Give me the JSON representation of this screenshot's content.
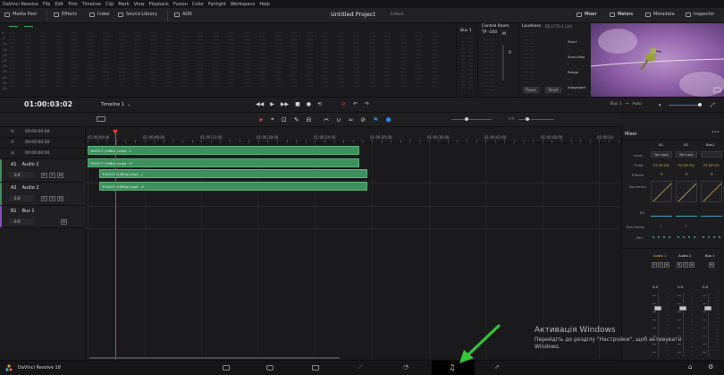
{
  "menu": [
    "DaVinci Resolve",
    "File",
    "Edit",
    "Trim",
    "Timeline",
    "Clip",
    "Mark",
    "View",
    "Playback",
    "Fusion",
    "Color",
    "Fairlight",
    "Workspace",
    "Help"
  ],
  "toolbar": {
    "media_pool": "Media Pool",
    "effects": "Effects",
    "index": "Index",
    "sound_library": "Sound Library",
    "adr": "ADR",
    "mixer": "Mixer",
    "meters": "Meters",
    "metadata": "Metadata",
    "inspector": "Inspector"
  },
  "project": {
    "title": "Untitled Project",
    "state": "Edited"
  },
  "meters": {
    "scale": [
      "0",
      "-5",
      "-10",
      "-15",
      "-20",
      "-25",
      "-30",
      "-35",
      "-40",
      "-45",
      "-50"
    ],
    "bus_label": "Bus 1"
  },
  "control_room": {
    "title": "Control Room",
    "tp_label": "TP",
    "tp_value": "-100",
    "m_label": "M",
    "value": "0"
  },
  "loudness": {
    "title": "Loudness",
    "standard": "BS.1770-1 (LU)",
    "labels": [
      "Short",
      "Short Max",
      "Range",
      "Integrated"
    ],
    "dashes": [
      "--",
      "--",
      "--",
      "--"
    ],
    "pause": "Pause",
    "reset": "Reset"
  },
  "transport": {
    "timecode": "01:00:03:02",
    "timeline_name": "Timeline 1",
    "bus_out": "Bus 1",
    "auto": "Auto"
  },
  "headers": {
    "tc_rows": [
      "00:00:00:00",
      "00:00:00:00",
      "00:00:00:00"
    ],
    "tc_letters": [
      "H",
      "H",
      "◎"
    ],
    "tracks": [
      {
        "id": "A1",
        "name": "Audio 1",
        "level": "0.0",
        "buttons": [
          "R",
          "S",
          "M"
        ]
      },
      {
        "id": "A2",
        "name": "Audio 2",
        "level": "0.0",
        "buttons": [
          "R",
          "S",
          "M"
        ]
      },
      {
        "id": "B1",
        "name": "Bus 1",
        "level": "0.0",
        "buttons": [
          "M"
        ]
      }
    ]
  },
  "ruler": [
    "01:00:00:00",
    "01:00:06:00",
    "01:00:12:00",
    "01:00:18:00",
    "01:00:24:00",
    "01:00:30:00",
    "01:00:36:00",
    "01:00:42:00",
    "01:00:48:00",
    "01:00:54:"
  ],
  "clips": [
    {
      "label": "382517 (1080p).mp4 - L"
    },
    {
      "label": "382517 (1080p).mp4 - R"
    },
    {
      "label": "330425 (1080p).mp4 - L"
    },
    {
      "label": "330425 (1080p).mp4 - R"
    }
  ],
  "mixer": {
    "title": "Mixer",
    "channels": [
      "A1",
      "A2",
      "Bus1"
    ],
    "row_labels": [
      "Input",
      "Order",
      "Effects",
      "Dynamics",
      "EQ",
      "Bus Sends",
      "Pan"
    ],
    "input_values": [
      "No Input",
      "No Input",
      ""
    ],
    "order_value": "FX DY EQ",
    "strip_names": [
      "Audio 1",
      "Audio 2",
      "Bus 1"
    ],
    "strip_buttons": [
      [
        "R",
        "S",
        "M"
      ],
      [
        "R",
        "S",
        "M"
      ],
      [
        "M"
      ]
    ],
    "fader_values": [
      "0.0",
      "0.0",
      "0.0"
    ]
  },
  "pagebar": {
    "app_name": "DaVinci Resolve 18"
  },
  "watermark": {
    "line1": "Активація Windows",
    "line2": "Перейдіть до розділу \"Настройки\", щоб активувати",
    "line3": "Windows."
  },
  "colors": {
    "clip": "#3d8f5c",
    "playhead": "#e53a3a",
    "annotation_arrow": "#35c738"
  }
}
